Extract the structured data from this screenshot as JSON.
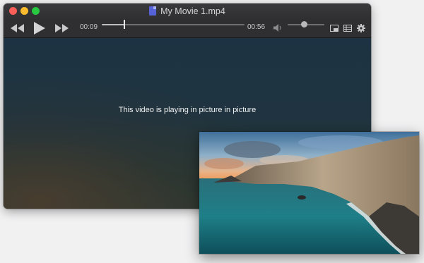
{
  "window": {
    "title": "My Movie 1.mp4",
    "traffic_lights": {
      "close": "#fc5f57",
      "minimize": "#fdbc2e",
      "zoom": "#28c840"
    }
  },
  "toolbar": {
    "rewind_icon": "rewind-icon",
    "play_icon": "play-icon",
    "fast_forward_icon": "fast-forward-icon",
    "current_time": "00:09",
    "duration": "00:56",
    "progress": 0.16,
    "volume_icon": "speaker-icon",
    "volume_level": 0.45,
    "pip_icon": "picture-in-picture-icon",
    "playlist_icon": "playlist-icon",
    "settings_icon": "gear-icon"
  },
  "video": {
    "message": "This video is playing in picture in picture"
  },
  "pip": {
    "content": "coastal-cliffs-video-frame"
  },
  "colors": {
    "toolbar_bg": "#2f2f31",
    "video_bg": "#1f3440",
    "accent_doc": "#5562d8"
  }
}
